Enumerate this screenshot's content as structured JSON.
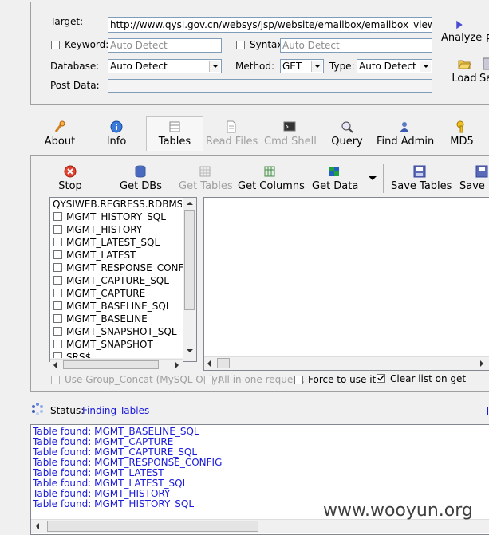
{
  "form": {
    "target_label": "Target:",
    "target_value": "http://www.qysi.gov.cn/websys/jsp/website/emailbox/emailbox_view.j",
    "keyword_label": "Keyword:",
    "keyword_placeholder": "Auto Detect",
    "syntax_label": "Syntax:",
    "syntax_placeholder": "Auto Detect",
    "database_label": "Database:",
    "database_value": "Auto Detect",
    "method_label": "Method:",
    "method_value": "GET",
    "type_label": "Type:",
    "type_value": "Auto Detect",
    "postdata_label": "Post Data:",
    "postdata_value": ""
  },
  "side_buttons": {
    "analyze": "Analyze",
    "load": "Load",
    "save_partial": "Sa",
    "p_partial": "P"
  },
  "main_tabs": [
    {
      "label": "About",
      "icon": "about-icon",
      "enabled": true
    },
    {
      "label": "Info",
      "icon": "info-icon",
      "enabled": true
    },
    {
      "label": "Tables",
      "icon": "tables-icon",
      "enabled": true,
      "selected": true
    },
    {
      "label": "Read Files",
      "icon": "read-files-icon",
      "enabled": false
    },
    {
      "label": "Cmd Shell",
      "icon": "cmd-shell-icon",
      "enabled": false
    },
    {
      "label": "Query",
      "icon": "query-icon",
      "enabled": true
    },
    {
      "label": "Find Admin",
      "icon": "find-admin-icon",
      "enabled": true
    },
    {
      "label": "MD5",
      "icon": "md5-icon",
      "enabled": true
    }
  ],
  "toolbar": {
    "stop": "Stop",
    "get_dbs": "Get DBs",
    "get_tables": "Get Tables",
    "get_columns": "Get Columns",
    "get_data": "Get Data",
    "save_tables": "Save Tables",
    "save_data_partial": "Save D"
  },
  "tree": {
    "root": "QYSIWEB.REGRESS.RDBMS.DE",
    "items": [
      "MGMT_HISTORY_SQL",
      "MGMT_HISTORY",
      "MGMT_LATEST_SQL",
      "MGMT_LATEST",
      "MGMT_RESPONSE_CONFIG",
      "MGMT_CAPTURE_SQL",
      "MGMT_CAPTURE",
      "MGMT_BASELINE_SQL",
      "MGMT_BASELINE",
      "MGMT_SNAPSHOT_SQL",
      "MGMT_SNAPSHOT",
      "SRS$"
    ]
  },
  "options": {
    "group_concat": "Use Group_Concat (MySQL Only)",
    "all_in_one": "All in one request.",
    "force_use": "Force to use it",
    "clear_list": "Clear list on get",
    "clear_list_checked": true
  },
  "status": {
    "label": "Status:",
    "value": "Finding Tables"
  },
  "log": [
    "Table found: MGMT_BASELINE_SQL",
    "Table found: MGMT_CAPTURE",
    "Table found: MGMT_CAPTURE_SQL",
    "Table found: MGMT_RESPONSE_CONFIG",
    "Table found: MGMT_LATEST",
    "Table found: MGMT_LATEST_SQL",
    "Table found: MGMT_HISTORY",
    "Table found: MGMT_HISTORY_SQL"
  ],
  "watermark": "www.wooyun.org",
  "colors": {
    "accent": "#1a1adb",
    "window_bg": "#f0f0f0",
    "selected_tab": "#f7f7f7"
  }
}
